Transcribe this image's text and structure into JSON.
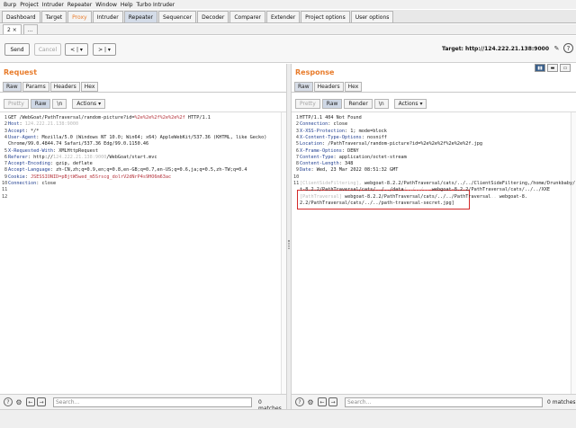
{
  "menubar": [
    "Burp",
    "Project",
    "Intruder",
    "Repeater",
    "Window",
    "Help",
    "Turbo Intruder"
  ],
  "main_tabs": [
    "Dashboard",
    "Target",
    "Proxy",
    "Intruder",
    "Repeater",
    "Sequencer",
    "Decoder",
    "Comparer",
    "Extender",
    "Project options",
    "User options"
  ],
  "sub_tabs": {
    "current": "2 ×",
    "more": "..."
  },
  "toolbar": {
    "send": "Send",
    "cancel": "Cancel",
    "back": "< | ▾",
    "forward": "> | ▾",
    "target": "Target: http://124.222.21.138:9000",
    "edit_icon": "pencil-icon",
    "help_icon": "help-icon"
  },
  "request": {
    "title": "Request",
    "tabs": [
      "Raw",
      "Params",
      "Headers",
      "Hex"
    ],
    "views": [
      "Pretty",
      "Raw",
      "\\n"
    ],
    "actions": "Actions ▾",
    "lines": [
      {
        "n": "1",
        "parts": [
          [
            "",
            "GET /WebGoat/PathTraversal/random-picture?id="
          ],
          [
            "req",
            "%2e%2e%2f%2e%2e%2f"
          ],
          [
            "",
            " HTTP/1.1"
          ]
        ]
      },
      {
        "n": "2",
        "parts": [
          [
            "k",
            "Host"
          ],
          [
            "",
            ": "
          ],
          [
            "blurred",
            "124.222.21.138:9000"
          ]
        ]
      },
      {
        "n": "3",
        "parts": [
          [
            "k",
            "Accept"
          ],
          [
            "",
            ": */*"
          ]
        ]
      },
      {
        "n": "4",
        "parts": [
          [
            "k",
            "User-Agent"
          ],
          [
            "",
            ": Mozilla/5.0 (Windows NT 10.0; Win64; x64) AppleWebKit/537.36 (KHTML, like Gecko)"
          ]
        ]
      },
      {
        "n": "",
        "parts": [
          [
            "",
            "Chrome/99.0.4844.74 Safari/537.36 Edg/99.0.1150.46"
          ]
        ]
      },
      {
        "n": "5",
        "parts": [
          [
            "k",
            "X-Requested-With"
          ],
          [
            "",
            ": XMLHttpRequest"
          ]
        ]
      },
      {
        "n": "6",
        "parts": [
          [
            "k",
            "Referer"
          ],
          [
            "",
            ": http://"
          ],
          [
            "blurred",
            "124.222.21.138:9000"
          ],
          [
            "",
            "/WebGoat/start.mvc"
          ]
        ]
      },
      {
        "n": "7",
        "parts": [
          [
            "k",
            "Accept-Encoding"
          ],
          [
            "",
            ": gzip, deflate"
          ]
        ]
      },
      {
        "n": "8",
        "parts": [
          [
            "k",
            "Accept-Language"
          ],
          [
            "",
            ": zh-CN,zh;q=0.9,en;q=0.8,en-GB;q=0.7,en-US;q=0.6,ja;q=0.5,zh-TW;q=0.4"
          ]
        ]
      },
      {
        "n": "9",
        "parts": [
          [
            "k",
            "Cookie"
          ],
          [
            "",
            ": "
          ],
          [
            "req",
            "JSESSIONID=pBjtW5wed_m5Srscg_dolrV2dNrP4s9HO6m63ac"
          ]
        ]
      },
      {
        "n": "10",
        "parts": [
          [
            "k",
            "Connection"
          ],
          [
            "",
            ": close"
          ]
        ]
      },
      {
        "n": "11",
        "parts": [
          [
            "",
            ""
          ]
        ]
      },
      {
        "n": "12",
        "parts": [
          [
            "",
            ""
          ]
        ]
      }
    ],
    "search_placeholder": "Search...",
    "matches": "0 matches"
  },
  "response": {
    "title": "Response",
    "tabs": [
      "Raw",
      "Headers",
      "Hex"
    ],
    "views": [
      "Pretty",
      "Raw",
      "Render",
      "\\n"
    ],
    "actions": "Actions ▾",
    "lines": [
      {
        "n": "1",
        "parts": [
          [
            "",
            "HTTP/1.1 404 Not Found"
          ]
        ]
      },
      {
        "n": "2",
        "parts": [
          [
            "k",
            "Connection"
          ],
          [
            "",
            ": close"
          ]
        ]
      },
      {
        "n": "3",
        "parts": [
          [
            "k",
            "X-XSS-Protection"
          ],
          [
            "",
            ": 1; mode=block"
          ]
        ]
      },
      {
        "n": "4",
        "parts": [
          [
            "k",
            "X-Content-Type-Options"
          ],
          [
            "",
            ": nosniff"
          ]
        ]
      },
      {
        "n": "5",
        "parts": [
          [
            "k",
            "Location"
          ],
          [
            "",
            ": /PathTraversal/random-picture?id=%2e%2e%2f%2e%2e%2f.jpg"
          ]
        ]
      },
      {
        "n": "6",
        "parts": [
          [
            "k",
            "X-Frame-Options"
          ],
          [
            "",
            ": DENY"
          ]
        ]
      },
      {
        "n": "7",
        "parts": [
          [
            "k",
            "Content-Type"
          ],
          [
            "",
            ": application/octet-stream"
          ]
        ]
      },
      {
        "n": "8",
        "parts": [
          [
            "k",
            "Content-Length"
          ],
          [
            "",
            ": 348"
          ]
        ]
      },
      {
        "n": "9",
        "parts": [
          [
            "k",
            "Date"
          ],
          [
            "",
            ": Wed, 23 Mar 2022 08:51:32 GMT"
          ]
        ]
      },
      {
        "n": "10",
        "parts": [
          [
            "",
            ""
          ]
        ]
      },
      {
        "n": "11",
        "parts": [
          [
            "blurred",
            "[ClientSideFiltering],"
          ],
          [
            "",
            " webgoat-8.2.2/PathTraversal/cats/../../ClientSideFiltering,/home/Drunkbaby/.webgoa"
          ]
        ]
      },
      {
        "n": "",
        "parts": [
          [
            "",
            "t-8.2.2/PathTraversal/cats/../../data"
          ],
          [
            "blurred",
            "/../../.."
          ],
          [
            "",
            " webgoat-8.2.2/PathTraversal/cats/../../XXE"
          ]
        ]
      },
      {
        "n": "",
        "parts": [
          [
            "blurred",
            "[PathTraversal]"
          ],
          [
            "",
            " webgoat-8.2.2/PathTraversal/cats/../../PathTraversal"
          ],
          [
            "blurred",
            ".."
          ],
          [
            "",
            " webgoat-8."
          ]
        ]
      },
      {
        "n": "",
        "parts": [
          [
            "",
            "2.2/PathTraversal/cats/../../path-traversal-secret.jpg]"
          ]
        ]
      }
    ],
    "search_placeholder": "Search...",
    "matches": "0 matches"
  },
  "colors": {
    "accent_orange": "#e87b2a",
    "highlight_red": "#d42a2a",
    "header_blue": "#1f3d8f"
  }
}
